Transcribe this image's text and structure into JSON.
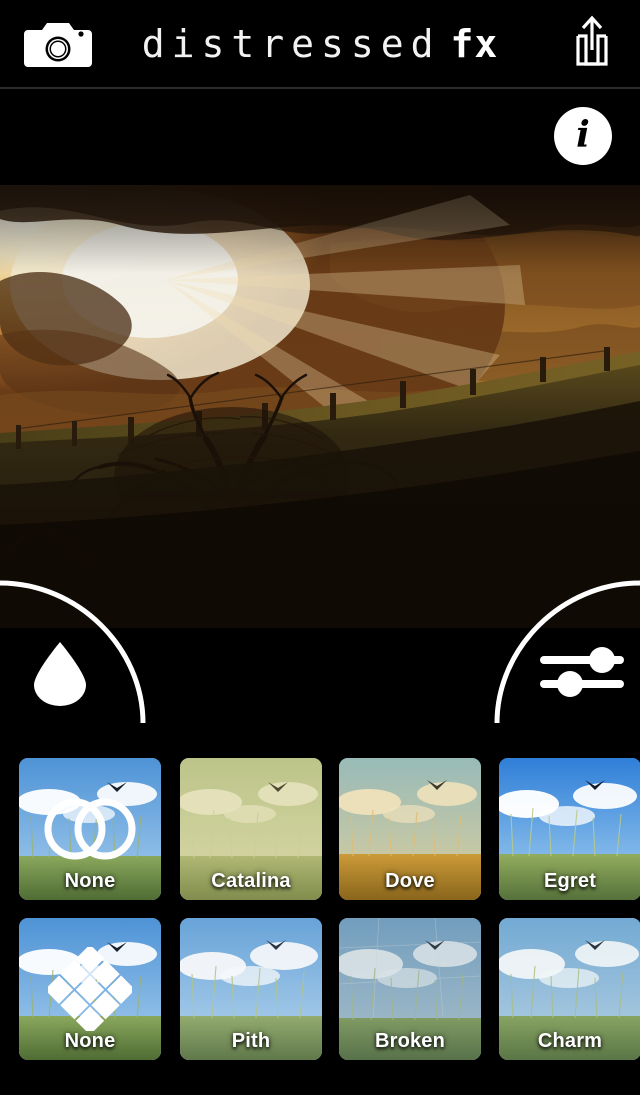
{
  "app": {
    "name": "distressed fx",
    "background_color": "#000000",
    "accent_color": "#ffffff"
  },
  "header": {
    "camera_icon": "camera-icon",
    "title_light": "distressed",
    "title_bold": "fx",
    "share_icon": "share-icon"
  },
  "infobar": {
    "info_label": "i",
    "info_icon": "info-icon"
  },
  "photo": {
    "alt": "Golden sunset over a field with a silhouetted tree, house roof at left and a fence line along the hill"
  },
  "toolbar": {
    "left_tool": {
      "name": "texture-drop",
      "icon": "water-drop-icon"
    },
    "right_tool": {
      "name": "adjustments",
      "icon": "sliders-icon"
    }
  },
  "filters": {
    "row_1": [
      {
        "label": "None",
        "icon": "venn-circles-icon",
        "selected": true,
        "tint": "rgba(0,0,0,0)",
        "sky": "#6ea5dc",
        "grass": "#6e8f4a"
      },
      {
        "label": "Catalina",
        "icon": null,
        "selected": false,
        "tint": "rgba(200,190,120,0.32)",
        "sky": "#c9ceA4",
        "grass": "#9aa861"
      },
      {
        "label": "Dove",
        "icon": null,
        "selected": false,
        "tint": "rgba(215,160,50,0.30)",
        "sky": "#9fc6d6",
        "grass": "#b98a33"
      },
      {
        "label": "Egret",
        "icon": null,
        "selected": false,
        "tint": "rgba(30,90,200,0.14)",
        "sky": "#3f8fe0",
        "grass": "#7aa14d"
      }
    ],
    "row_2": [
      {
        "label": "None",
        "icon": "diamond-grid-icon",
        "selected": true,
        "tint": "rgba(0,0,0,0)",
        "sky": "#6ea5dc",
        "grass": "#6e8f4a"
      },
      {
        "label": "Pith",
        "icon": null,
        "selected": false,
        "tint": "rgba(190,205,225,0.18)",
        "sky": "#78aadd",
        "grass": "#7a9a55"
      },
      {
        "label": "Broken",
        "icon": null,
        "selected": false,
        "tint": "rgba(150,170,185,0.30)",
        "sky": "#8fb0c6",
        "grass": "#6c8a4e"
      },
      {
        "label": "Charm",
        "icon": null,
        "selected": false,
        "tint": "rgba(180,195,205,0.18)",
        "sky": "#86b4d8",
        "grass": "#72944f"
      }
    ]
  }
}
